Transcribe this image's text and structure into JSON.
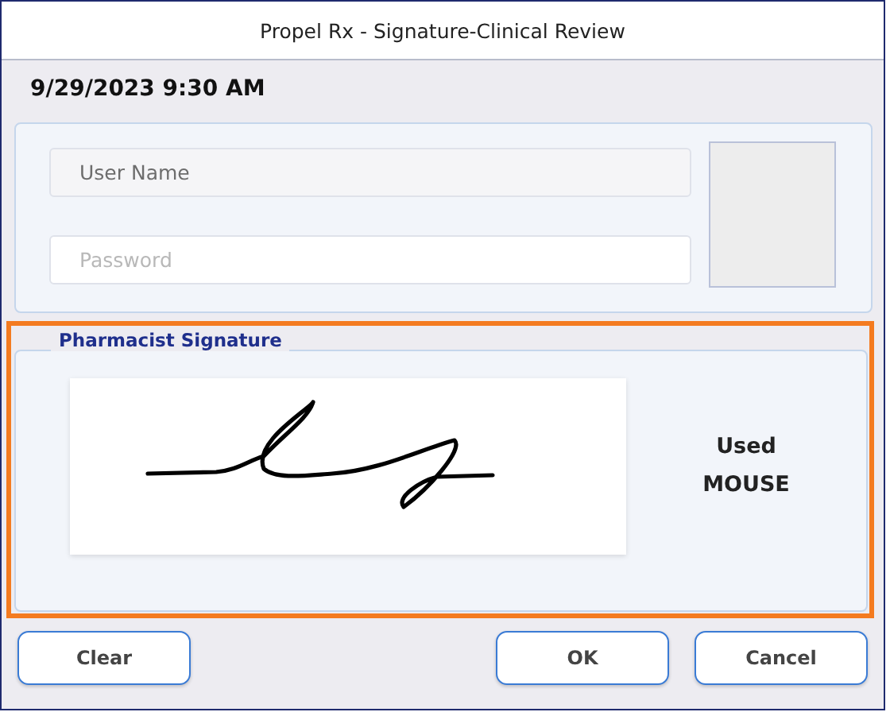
{
  "window": {
    "title": "Propel Rx - Signature-Clinical Review"
  },
  "timestamp": "9/29/2023 9:30 AM",
  "fields": [
    {
      "placeholder": "User Name",
      "disabled": true
    },
    {
      "placeholder": "Password",
      "disabled": false
    }
  ],
  "signature": {
    "legend": "Pharmacist Signature",
    "focused": true,
    "method_label": "Used",
    "method": "MOUSE"
  },
  "buttons": [
    {
      "label": "Clear"
    },
    {
      "label": "OK"
    },
    {
      "label": "Cancel"
    }
  ]
}
